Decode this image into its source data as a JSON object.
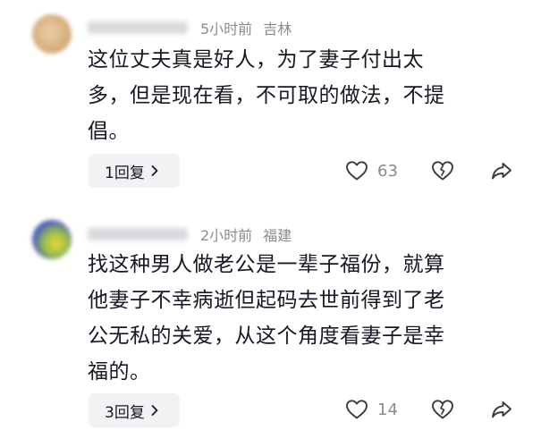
{
  "comments": [
    {
      "time": "5小时前",
      "location": "吉林",
      "text_lines": [
        "这位丈夫真是好人，为了妻子付出太",
        "多，但是现在看，不可取的做法，不提",
        "倡。"
      ],
      "reply_label": "1回复",
      "like_count": "63"
    },
    {
      "time": "2小时前",
      "location": "福建",
      "text_lines": [
        "找这种男人做老公是一辈子福份，就算",
        "他妻子不幸病逝但起码去世前得到了老",
        "公无私的关爱，从这个角度看妻子是幸",
        "福的。"
      ],
      "reply_label": "3回复",
      "like_count": "14"
    }
  ],
  "icons": {
    "like": "heart-icon",
    "dislike": "broken-heart-icon",
    "share": "share-arrow-icon",
    "chevron": "chevron-right-icon"
  },
  "colors": {
    "text": "#161823",
    "meta": "#8a8b91",
    "button_bg": "#f2f2f4"
  }
}
